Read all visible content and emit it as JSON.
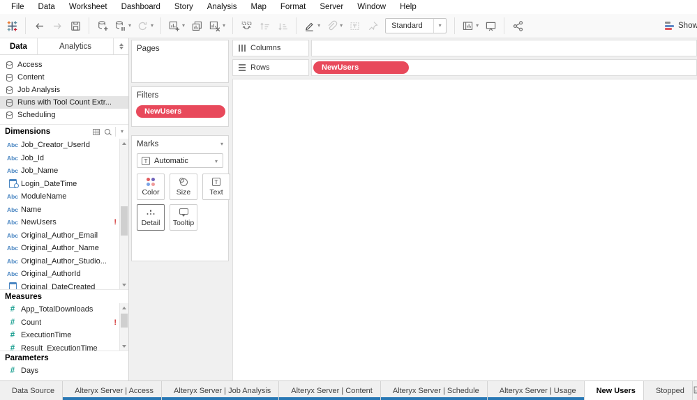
{
  "menu": {
    "items": [
      "File",
      "Data",
      "Worksheet",
      "Dashboard",
      "Story",
      "Analysis",
      "Map",
      "Format",
      "Server",
      "Window",
      "Help"
    ]
  },
  "toolbar": {
    "icons": [
      "tableau-logo",
      "undo",
      "redo",
      "save",
      "new-data-source",
      "pause-auto-updates",
      "refresh-data-source",
      "new-worksheet",
      "duplicate-sheet",
      "clear-sheet",
      "swap-rows-columns",
      "sort-ascending",
      "sort-descending",
      "highlight",
      "group-members",
      "show-mark-labels",
      "fix-axes",
      "fit-selector",
      "show-hide-cards",
      "presentation-mode",
      "share-workbook",
      "show-me"
    ],
    "view_mode": "Standard",
    "show_me_label": "Show Me"
  },
  "data_pane": {
    "tabs": [
      {
        "label": "Data",
        "active": true
      },
      {
        "label": "Analytics",
        "active": false
      }
    ],
    "sources": [
      {
        "label": "Access",
        "selected": false,
        "icon": "database"
      },
      {
        "label": "Content",
        "selected": false,
        "icon": "database"
      },
      {
        "label": "Job Analysis",
        "selected": false,
        "icon": "database"
      },
      {
        "label": "Runs with Tool Count Extr...",
        "selected": true,
        "icon": "database-extract"
      },
      {
        "label": "Scheduling",
        "selected": false,
        "icon": "database"
      }
    ],
    "dimensions": {
      "header": "Dimensions",
      "fields": [
        {
          "label": "Job_Creator_UserId",
          "type": "abc"
        },
        {
          "label": "Job_Id",
          "type": "abc"
        },
        {
          "label": "Job_Name",
          "type": "abc"
        },
        {
          "label": "Login_DateTime",
          "type": "datetime"
        },
        {
          "label": "ModuleName",
          "type": "abc"
        },
        {
          "label": "Name",
          "type": "abc"
        },
        {
          "label": "NewUsers",
          "type": "abc",
          "error": true
        },
        {
          "label": "Original_Author_Email",
          "type": "abc"
        },
        {
          "label": "Original_Author_Name",
          "type": "abc"
        },
        {
          "label": "Original_Author_Studio...",
          "type": "abc"
        },
        {
          "label": "Original_AuthorId",
          "type": "abc"
        },
        {
          "label": "Original_DateCreated",
          "type": "date"
        }
      ]
    },
    "measures": {
      "header": "Measures",
      "fields": [
        {
          "label": "App_TotalDownloads",
          "type": "num"
        },
        {
          "label": "Count",
          "type": "num",
          "error": true
        },
        {
          "label": "ExecutionTime",
          "type": "num"
        },
        {
          "label": "Result_ExecutionTime",
          "type": "num"
        }
      ]
    },
    "parameters": {
      "header": "Parameters",
      "fields": [
        {
          "label": "Days",
          "type": "num"
        }
      ]
    }
  },
  "cards": {
    "pages": {
      "title": "Pages"
    },
    "filters": {
      "title": "Filters",
      "pills": [
        {
          "label": "NewUsers",
          "color": "#e8495b"
        }
      ]
    },
    "marks": {
      "title": "Marks",
      "mark_type": "Automatic",
      "buttons": {
        "color": "Color",
        "size": "Size",
        "text": "Text",
        "detail": "Detail",
        "tooltip": "Tooltip"
      }
    }
  },
  "shelves": {
    "columns": {
      "label": "Columns",
      "pills": []
    },
    "rows": {
      "label": "Rows",
      "pills": [
        {
          "label": "NewUsers",
          "color": "#e8495b"
        }
      ]
    }
  },
  "bottom_tabs": {
    "tabs": [
      {
        "label": "Data Source",
        "icon": "database",
        "state": "plain"
      },
      {
        "label": "Alteryx Server | Access",
        "icon": "sheet",
        "state": "blue"
      },
      {
        "label": "Alteryx Server | Job Analysis",
        "icon": "sheet",
        "state": "blue"
      },
      {
        "label": "Alteryx Server | Content",
        "icon": "sheet",
        "state": "blue"
      },
      {
        "label": "Alteryx Server | Schedule",
        "icon": "sheet",
        "state": "blue"
      },
      {
        "label": "Alteryx Server | Usage",
        "icon": "sheet",
        "state": "blue"
      },
      {
        "label": "New Users",
        "icon": "none",
        "state": "active"
      },
      {
        "label": "Stopped",
        "icon": "none",
        "state": "plain"
      }
    ]
  },
  "colors": {
    "pill_red": "#e8495b",
    "tab_accent_blue": "#2978b5",
    "dimension_icon_blue": "#4a86c2",
    "measure_icon_green": "#159d8e",
    "error_red": "#d43f3f"
  }
}
